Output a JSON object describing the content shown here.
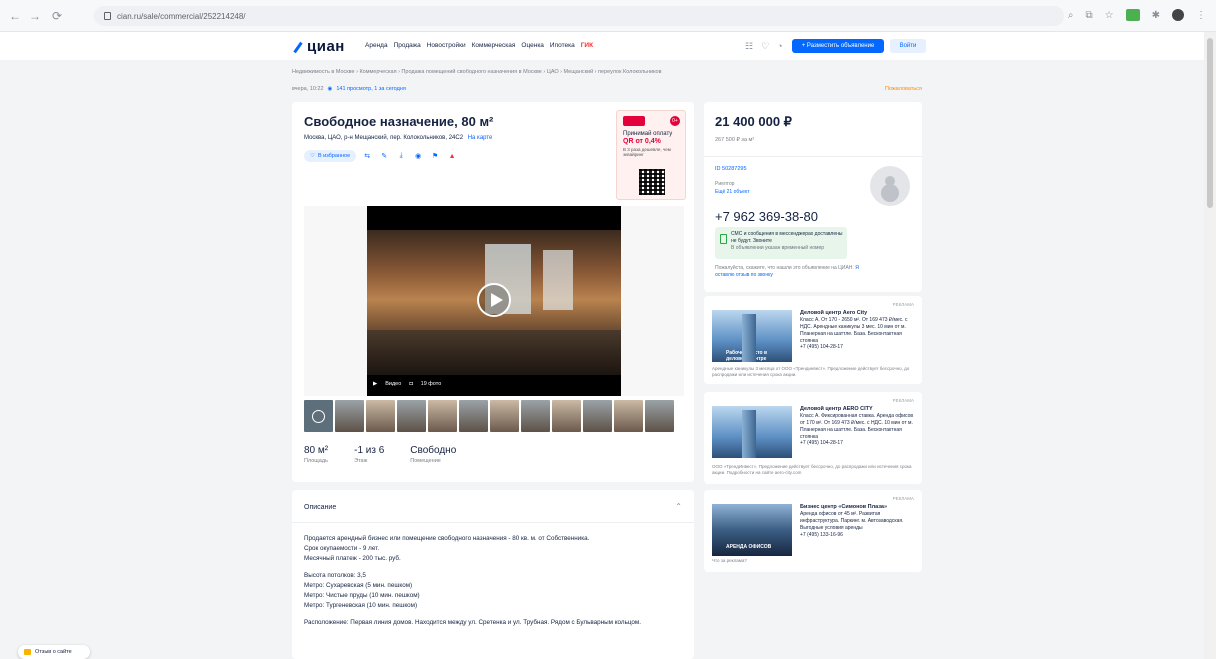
{
  "browser": {
    "url": "cian.ru/sale/commercial/252214248/"
  },
  "header": {
    "logo": "циан",
    "nav": [
      "Аренда",
      "Продажа",
      "Новостройки",
      "Коммерческая",
      "Оценка",
      "Ипотека"
    ],
    "nav_highlight": "ГИК",
    "place_button": "+ Разместить объявление",
    "login_button": "Войти"
  },
  "breadcrumbs": "Недвижимость в Москве  ›  Коммерческая  ›  Продажа помещений свободного назначения в Москве  ›  ЦАО  ›  Мещанский  ›  переулок Колокольников",
  "meta": {
    "updated": "вчера, 10:22",
    "views": "141 просмотр, 1 за сегодня",
    "complain": "Пожаловаться"
  },
  "listing": {
    "title": "Свободное назначение, 80 м²",
    "address": "Москва, ЦАО, р-н Мещанский, пер. Колокольников, 24С2",
    "map_link": "На карте",
    "favorite": "В избранное",
    "video_label": "Видео",
    "photo_count": "19 фото",
    "facts": [
      {
        "value": "80 м²",
        "label": "Площадь"
      },
      {
        "value": "-1 из 6",
        "label": "Этаж"
      },
      {
        "value": "Свободно",
        "label": "Помещение"
      }
    ]
  },
  "banner": {
    "line1": "Принимай оплату",
    "rate": "QR от 0,4%",
    "line2": "В 3 раза дешевле, чем эквайринг"
  },
  "description": {
    "heading": "Описание",
    "paragraphs": [
      "Продается арендный бизнес или помещение свободного назначения - 80 кв. м. от Собственника.",
      "Срок окупаемости - 9 лет.",
      "Месячный платеж - 200 тыс. руб.",
      "Высота потолков: 3,5",
      "Метро: Сухаревская (5 мин. пешком)",
      "Метро: Чистые пруды (10 мин. пешком)",
      "Метро: Тургеневская (10 мин. пешком)",
      "Расположение: Первая линия домов. Находится между ул. Сретенка и ул. Трубная. Рядом с Бульварным кольцом."
    ]
  },
  "price_card": {
    "price": "21 400 000 ₽",
    "per_meter": "267 500 ₽ за м²",
    "agent_id": "ID 50287295",
    "agent_role": "Риелтор",
    "agent_more": "Ещё 21 объект",
    "phone": "+7 962 369-38-80",
    "sms_text": "СМС и сообщения в мессенджерах доставлены не будут. Звоните",
    "sms_note": "В объявлении указан временный номер",
    "disclaimer": "Пожалуйста, скажите, что нашли это объявление на ЦИАН.",
    "disclaimer_link": "Я оставлю отзыв по звонку"
  },
  "ads": [
    {
      "tag": "РЕКЛАМА",
      "img_caption": "Рабочее место в деловом центре",
      "name": "Деловой центр Aero City",
      "text": "Класс А. От 170 - 2650 м². От 169 473 ₽/мес. с НДС. Арендные каникулы 3 мес. 10 мин от м. Планерная на шаттле. База. Бесконтактная стоянка",
      "phone": "+7 (495) 104-28-17",
      "foot": "Арендные каникулы 3 месяца от ООО «Трендинвест». Предложение действует бессрочно, до распродажи или истечения срока акции."
    },
    {
      "tag": "РЕКЛАМА",
      "img_caption": "",
      "name": "Деловой центр AERO CITY",
      "text": "Класс А. Фиксированная ставка. Аренда офисов от 170 м². От 169 473 ₽/мес. с НДС. 10 мин от м. Планерная на шаттле. База. Бесконтактная стоянка",
      "phone": "+7 (495) 104-28-17",
      "foot": "ООО «ТрендИнвест». Предложение действует бессрочно, до распродажи или истечения срока акции. Подробности на сайте aero-city.com"
    },
    {
      "tag": "РЕКЛАМА",
      "img_caption": "АРЕНДА ОФИСОВ",
      "name": "Бизнес центр «Симонов Плаза»",
      "text": "Аренда офисов от 45 м². Развитая инфраструктура. Паркинг. м. Автозаводская. Выгодные условия аренды",
      "phone": "+7 (495) 133-16-96",
      "foot": "Что за реклама?"
    }
  ],
  "feedback": "Отзыв о сайте"
}
